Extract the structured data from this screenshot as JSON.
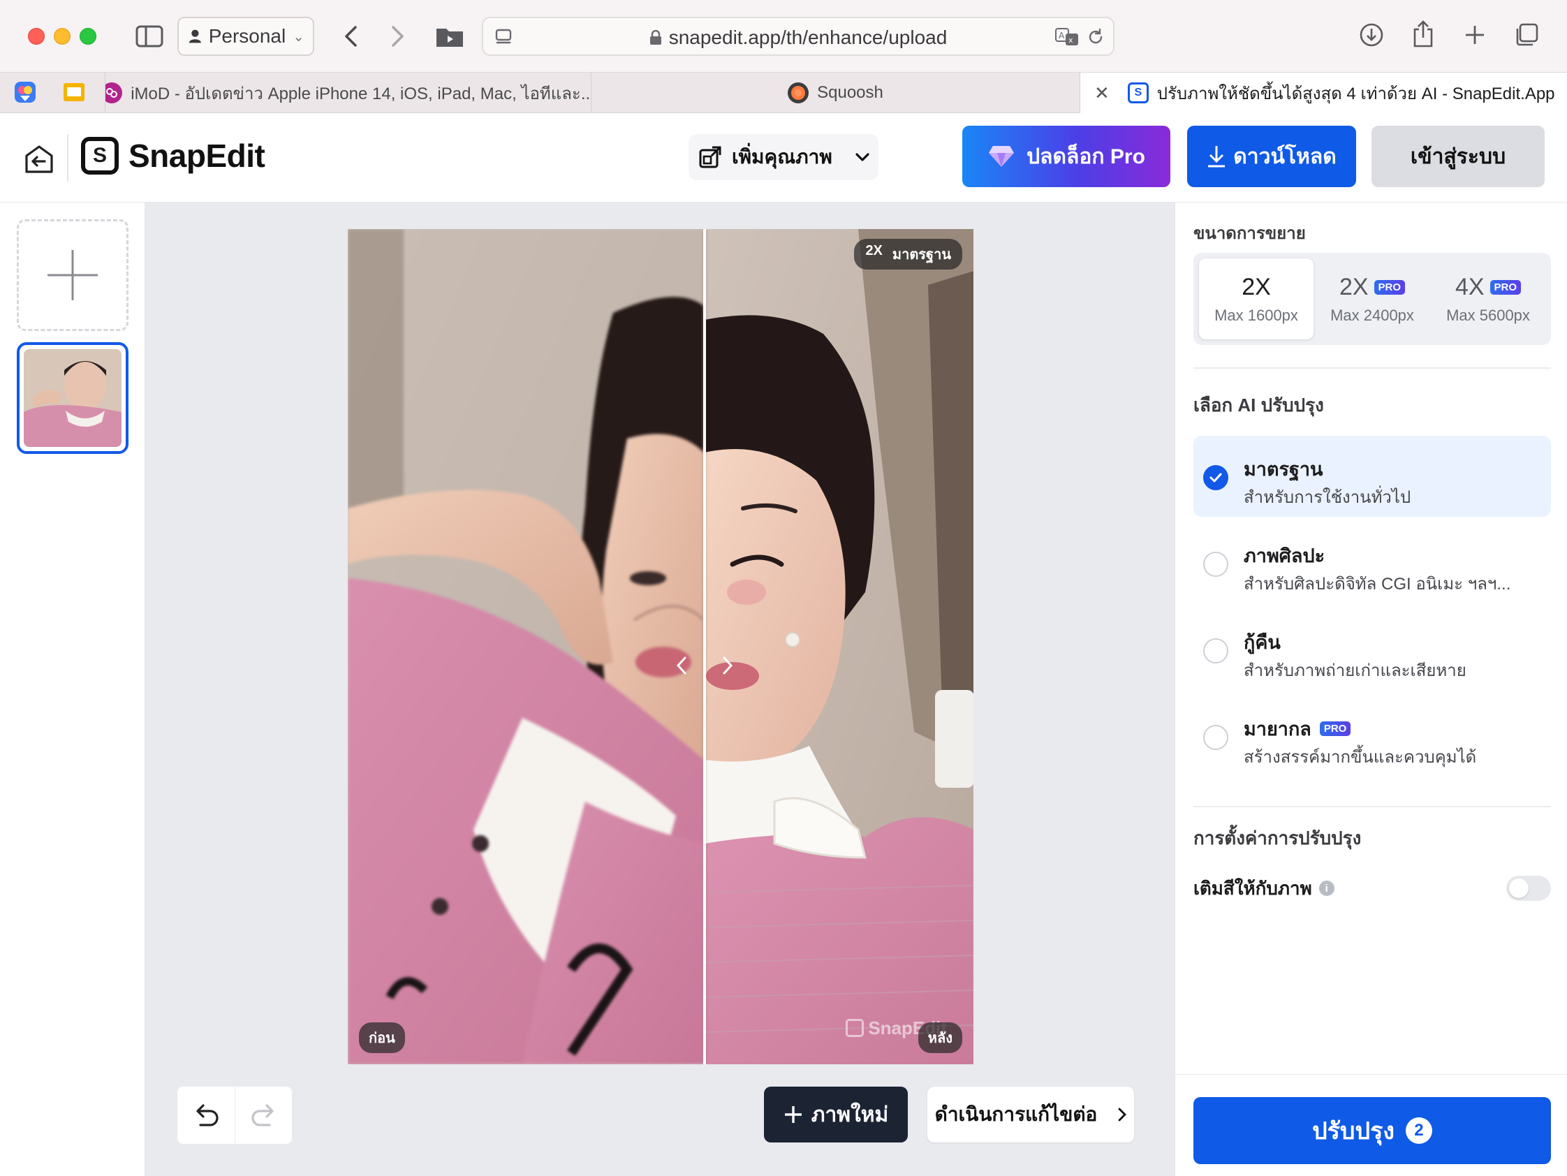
{
  "browser": {
    "profile_label": "Personal",
    "url": "snapedit.app/th/enhance/upload",
    "tabs": [
      {
        "title": "iMoD - อัปเดตข่าว Apple iPhone 14, iOS, iPad, Mac, ไอทีและ..."
      },
      {
        "title": "Squoosh"
      },
      {
        "title": "ปรับภาพให้ชัดขึ้นได้สูงสุด 4 เท่าด้วย AI - SnapEdit.App"
      }
    ]
  },
  "app": {
    "logo_text": "SnapEdit",
    "mode_label": "เพิ่มคุณภาพ",
    "unlock_pro_label": "ปลดล็อก Pro",
    "download_label": "ดาวน์โหลด",
    "login_label": "เข้าสู่ระบบ"
  },
  "canvas": {
    "badge_scale": "2X",
    "badge_mode": "มาตรฐาน",
    "before_label": "ก่อน",
    "after_label": "หลัง",
    "watermark": "SnapEdit",
    "new_image_label": "ภาพใหม่",
    "continue_label": "ดำเนินการแก้ไขต่อ",
    "split_position": 0.57
  },
  "panel": {
    "scale_heading": "ขนาดการขยาย",
    "scale_options": [
      {
        "label": "2X",
        "max": "Max 1600px",
        "pro": false,
        "selected": true
      },
      {
        "label": "2X",
        "max": "Max 2400px",
        "pro": true,
        "selected": false
      },
      {
        "label": "4X",
        "max": "Max 5600px",
        "pro": true,
        "selected": false
      }
    ],
    "pro_tag": "PRO",
    "ai_heading": "เลือก AI ปรับปรุง",
    "ai_options": [
      {
        "title": "มาตรฐาน",
        "desc": "สำหรับการใช้งานทั่วไป",
        "selected": true
      },
      {
        "title": "ภาพศิลปะ",
        "desc": "สำหรับศิลปะดิจิทัล CGI อนิเมะ ฯลฯ...",
        "selected": false
      },
      {
        "title": "กู้คืน",
        "desc": "สำหรับภาพถ่ายเก่าและเสียหาย",
        "selected": false
      },
      {
        "title": "มายากล",
        "desc": "สร้างสรรค์มากขึ้นและควบคุมได้",
        "selected": false,
        "pro": true
      }
    ],
    "settings_heading": "การตั้งค่าการปรับปรุง",
    "colorize_label": "เติมสีให้กับภาพ",
    "colorize_on": false,
    "enhance_label": "ปรับปรุง",
    "enhance_count": "2"
  },
  "colors": {
    "primary": "#0f5ae6",
    "dark_button": "#1c2333",
    "selected_bg": "#eaf2ff"
  }
}
